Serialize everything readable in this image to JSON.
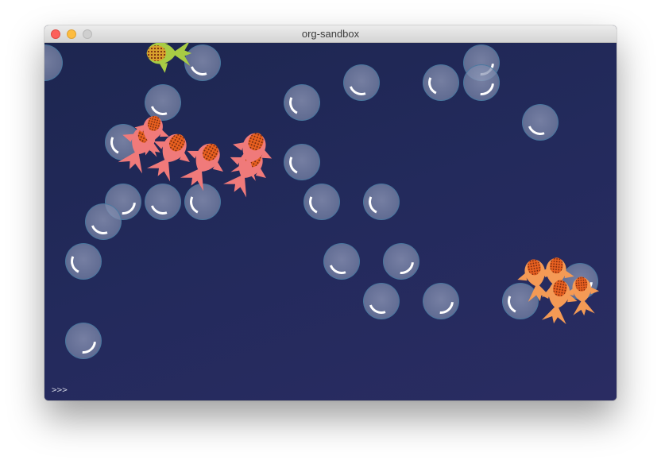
{
  "window": {
    "title": "org-sandbox"
  },
  "console": {
    "prompt": ">>>"
  },
  "colors": {
    "background": "#222a58",
    "bubble_rim": "#4678a0",
    "fish_red": "#f07a7a",
    "fish_orange": "#f49a55",
    "fish_green": "#a8cc44"
  },
  "scene": {
    "bubble_count": 27,
    "fish_groups": [
      {
        "color": "red",
        "count": 6
      },
      {
        "color": "orange",
        "count": 4
      },
      {
        "color": "green",
        "count": 1
      }
    ]
  }
}
